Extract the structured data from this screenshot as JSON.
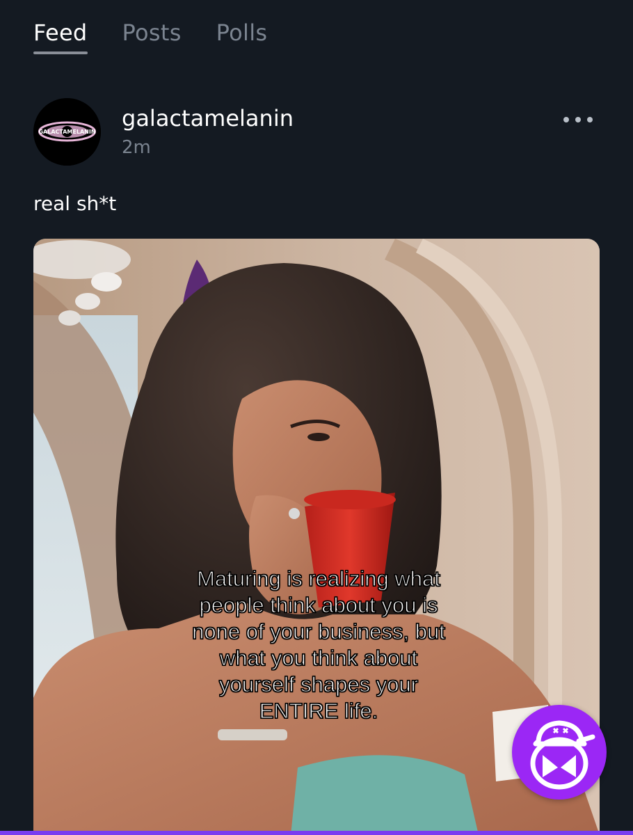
{
  "tabs": [
    {
      "label": "Feed",
      "active": true
    },
    {
      "label": "Posts",
      "active": false
    },
    {
      "label": "Polls",
      "active": false
    }
  ],
  "post": {
    "author": "galactamelanin",
    "time": "2m",
    "avatar_text": "GALACTAMELANIN",
    "text": "real sh*t",
    "more_icon": "more-horizontal-icon",
    "image_caption": "Maturing is realizing what\npeople think about you is\nnone of your business, but\nwhat you think about\nyourself shapes your\nENTIRE life."
  },
  "fab": {
    "icon": "mascot-face-icon",
    "color": "#9b27f5"
  },
  "colors": {
    "background": "#141a22",
    "muted_text": "#7b8490",
    "accent": "#9b27f5"
  }
}
